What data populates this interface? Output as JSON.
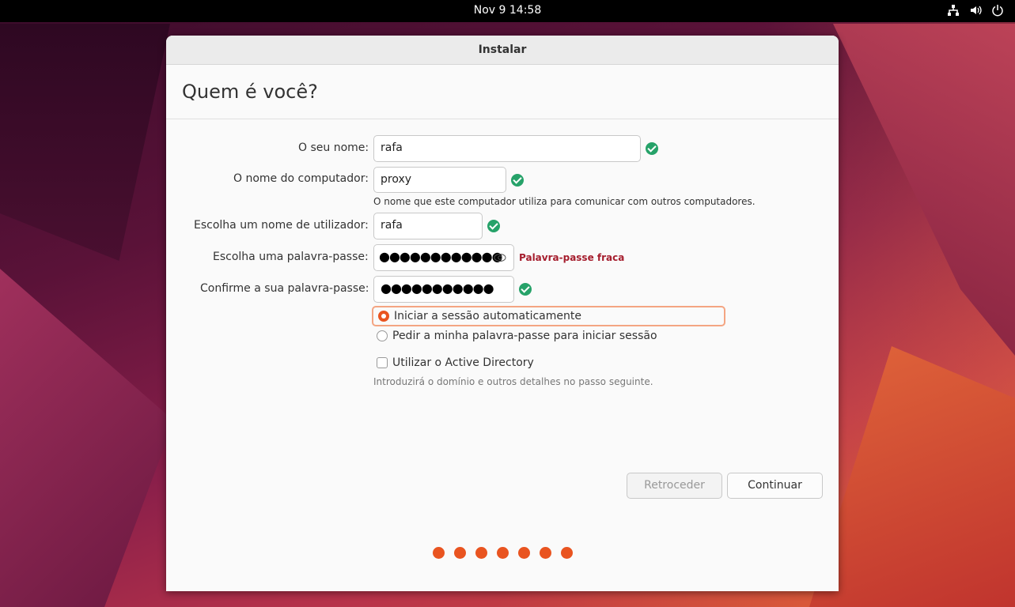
{
  "topbar": {
    "clock": "Nov 9  14:58",
    "tray_icons": [
      "network-icon",
      "volume-icon",
      "power-icon"
    ]
  },
  "window": {
    "title": "Instalar",
    "heading": "Quem é você?"
  },
  "form": {
    "name": {
      "label": "O seu nome:",
      "value": "rafa"
    },
    "computer": {
      "label": "O nome do computador:",
      "value": "proxy",
      "hint": "O nome que este computador utiliza para comunicar com outros computadores."
    },
    "username": {
      "label": "Escolha um nome de utilizador:",
      "value": "rafa"
    },
    "password": {
      "label": "Escolha uma palavra-passe:",
      "value": "●●●●●●●●●●●●",
      "strength": "Palavra-passe fraca"
    },
    "confirm": {
      "label": "Confirme a sua palavra-passe:",
      "value": "●●●●●●●●●●●"
    },
    "login_options": [
      {
        "label": "Iniciar a sessão automaticamente",
        "selected": true
      },
      {
        "label": "Pedir a minha palavra-passe para iniciar sessão",
        "selected": false
      }
    ],
    "active_directory": {
      "label": "Utilizar o Active Directory",
      "checked": false,
      "hint": "Introduzirá o domínio e outros detalhes no passo seguinte."
    }
  },
  "buttons": {
    "back": "Retroceder",
    "continue": "Continuar"
  },
  "progress": {
    "steps": 7
  },
  "colors": {
    "accent": "#e95420",
    "success": "#26a269",
    "error": "#a51d2d"
  }
}
